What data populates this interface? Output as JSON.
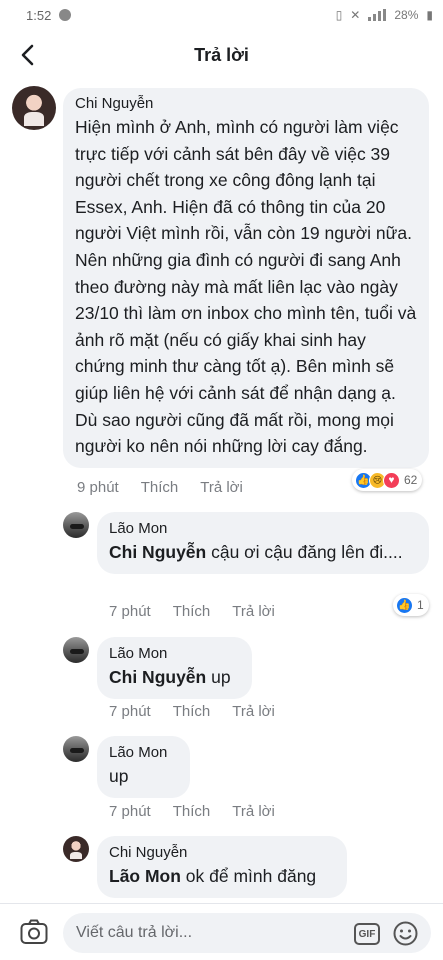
{
  "status_bar": {
    "time": "1:52",
    "battery": "28%"
  },
  "header": {
    "title": "Trả lời",
    "back_icon": "back-arrow-icon"
  },
  "comments": [
    {
      "author": "Chi Nguyễn",
      "text": "Hiện mình ở Anh, mình có người làm việc trực tiếp với cảnh sát bên đây về việc 39 người chết trong xe công đông lạnh tại Essex, Anh. Hiện đã có thông tin của 20 người Việt mình rồi, vẫn còn 19 người nữa. Nên những gia đình có người đi sang Anh theo đường này mà mất liên lạc vào ngày 23/10 thì làm ơn inbox cho mình tên, tuổi và ảnh rõ mặt (nếu có giấy khai sinh hay chứng minh thư càng tốt ạ). Bên mình sẽ giúp liên hệ với cảnh sát để nhận dạng ạ. Dù sao người cũng đã mất rồi, mong mọi người ko nên nói những lời cay đắng.",
      "time": "9 phút",
      "like": "Thích",
      "reply": "Trả lời",
      "reactions": [
        "like",
        "sad",
        "love"
      ],
      "reaction_count": "62"
    },
    {
      "author": "Lão Mon",
      "mention": "Chi Nguyễn",
      "text": " cậu ơi cậu đăng lên đi....",
      "time": "7 phút",
      "like": "Thích",
      "reply": "Trả lời",
      "reactions": [
        "like"
      ],
      "reaction_count": "1"
    },
    {
      "author": "Lão Mon",
      "mention": "Chi Nguyễn",
      "text": " up",
      "time": "7 phút",
      "like": "Thích",
      "reply": "Trả lời"
    },
    {
      "author": "Lão Mon",
      "text": "up",
      "time": "7 phút",
      "like": "Thích",
      "reply": "Trả lời"
    },
    {
      "author": "Chi Nguyễn",
      "mention": "Lão Mon",
      "text": " ok để mình đăng"
    }
  ],
  "composer": {
    "placeholder": "Viết câu trả lời...",
    "gif_label": "GIF",
    "camera_icon": "camera-icon",
    "emoji_icon": "emoji-icon"
  },
  "colors": {
    "bubble": "#f0f2f5",
    "meta": "#7a7d82",
    "like_blue": "#1877f2",
    "love_red": "#f33e58",
    "sad_yellow": "#f7b928"
  }
}
